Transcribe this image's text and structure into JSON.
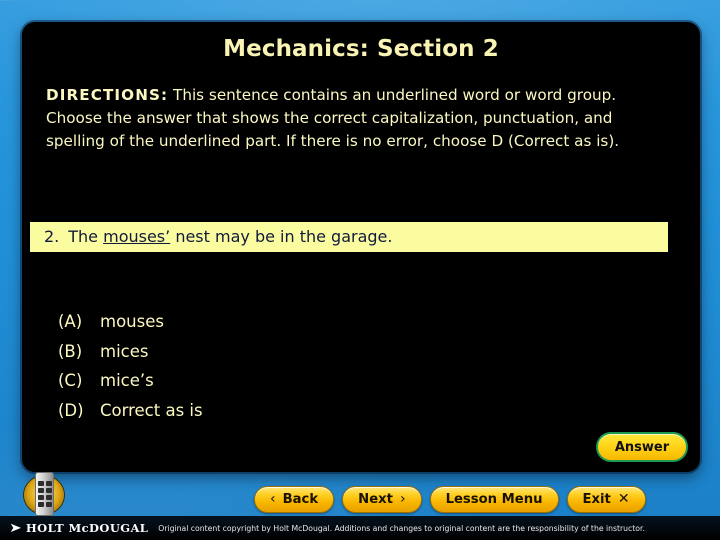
{
  "panel": {
    "title": "Mechanics: Section 2",
    "directions": {
      "lead": "DIRECTIONS:",
      "body": " This sentence contains an underlined word or word group. Choose the answer that shows the correct capitalization, punctuation, and spelling of the underlined part. If there is no error, choose D (Correct as is)."
    },
    "question": {
      "number": "2.",
      "before": "The ",
      "underlined": "mouses’",
      "after": " nest may be in the garage."
    },
    "choices": [
      {
        "letter": "(A)",
        "text": "mouses"
      },
      {
        "letter": "(B)",
        "text": "mices"
      },
      {
        "letter": "(C)",
        "text": "mice’s"
      },
      {
        "letter": "(D)",
        "text": "Correct as is"
      }
    ],
    "answer_button": "Answer"
  },
  "nav": {
    "back": {
      "label": "Back",
      "icon": "‹"
    },
    "next": {
      "label": "Next",
      "icon": "›"
    },
    "lesson_menu": {
      "label": "Lesson Menu"
    },
    "exit": {
      "label": "Exit",
      "icon": "✕"
    }
  },
  "footer": {
    "logo_mark": "➤",
    "wordmark": "HOLT McDOUGAL",
    "copyright": "Original content copyright by Holt McDougal.  Additions and changes to original content are the responsibility of the instructor."
  },
  "colors": {
    "backdrop_blue": "#2190d8",
    "panel_black": "#000000",
    "title_yellow": "#faf4b4",
    "highlight_yellow": "#fbfba0",
    "button_gold": "#ffcf23",
    "answer_border_green": "#1f9a52"
  }
}
